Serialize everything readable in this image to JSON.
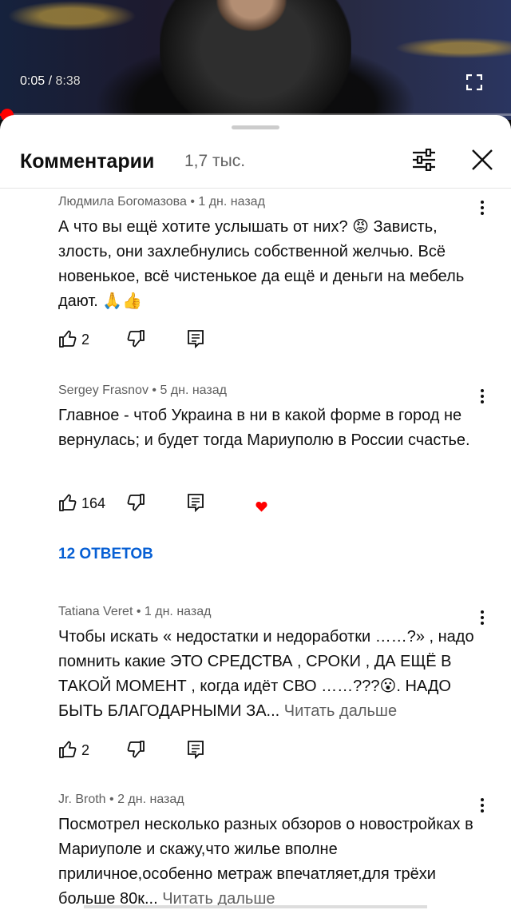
{
  "player": {
    "current_time": "0:05",
    "separator": " / ",
    "duration": "8:38",
    "progress_fraction": 0.01,
    "fullscreen_icon": "fullscreen-icon"
  },
  "panel": {
    "title": "Комментарии",
    "count": "1,7 тыс.",
    "filter_icon": "sliders-icon",
    "close_icon": "close-icon"
  },
  "comments": [
    {
      "author": "Людмила Богомазова",
      "age": "1 дн. назад",
      "text": "А что вы ещё хотите услышать от них? 😡 Зависть, злость, они захлебнулись собственной желчью. Всё новенькое, всё чистенькое да ещё и деньги на мебель дают. 🙏👍",
      "likes": "2"
    },
    {
      "author": "Sergey Frasnov",
      "age": "5 дн. назад",
      "text": "Главное - чтоб Украина в ни в какой форме в город не вернулась; и будет тогда Мариуполю в России счастье.",
      "likes": "164",
      "replies_label": "12 ОТВЕТОВ"
    },
    {
      "author": "Tatiana Veret",
      "age": "1 дн. назад",
      "text": "Чтобы искать « недостатки и недоработки ……?» , надо помнить какие ЭТО СРЕДСТВА , СРОКИ , ДА ЕЩЁ В ТАКОЙ МОМЕНТ ,  когда идёт СВО ……???😮. НАДО БЫТЬ БЛАГОДАРНЫМИ ЗА...",
      "more_label": "Читать дальше",
      "likes": "2"
    },
    {
      "author": "Jr. Broth",
      "age": "2 дн. назад",
      "text": "Посмотрел несколько разных обзоров о новостройках в Мариуполе и скажу,что жилье вполне приличное,особенно метраж впечатляет,для трёхи больше 80к...",
      "more_label": "Читать дальше"
    }
  ],
  "meta_separator": " • ",
  "colors": {
    "accent_blue": "#065fd4",
    "progress_red": "#ff0000",
    "secondary_text": "#606060"
  }
}
